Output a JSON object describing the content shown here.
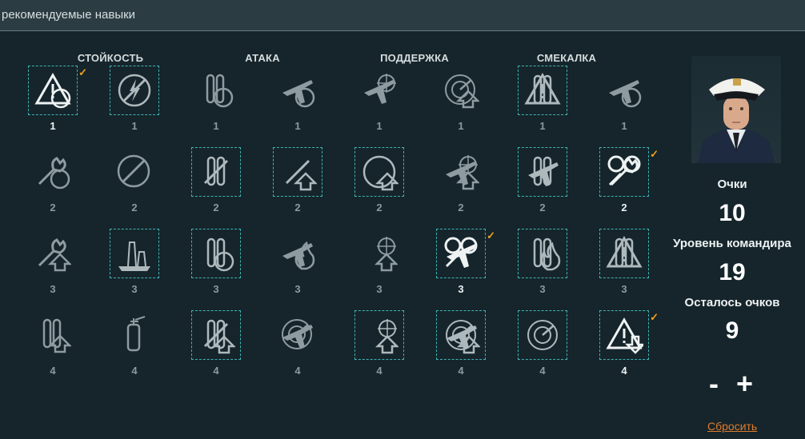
{
  "header": {
    "title": "рекомендуемые навыки"
  },
  "categories": [
    "СТОЙКОСТЬ",
    "АТАКА",
    "ПОДДЕРЖКА",
    "СМЕКАЛКА"
  ],
  "colors": {
    "accent_border": "#3fb3b6",
    "check": "#f0a21c",
    "reset_link": "#e07b2e"
  },
  "rows": [
    {
      "cost": "1",
      "skills": [
        {
          "icon": "warning-target-icon",
          "selected": true,
          "checked": true
        },
        {
          "icon": "no-lightning-icon",
          "selected": true,
          "checked": false
        },
        {
          "icon": "torpedo-timer-icon",
          "selected": false,
          "checked": false
        },
        {
          "icon": "plane-timer-icon",
          "selected": false,
          "checked": false
        },
        {
          "icon": "plane-crosshair-icon",
          "selected": false,
          "checked": false
        },
        {
          "icon": "radar-upgrade-icon",
          "selected": false,
          "checked": false
        },
        {
          "icon": "ship-warning-icon",
          "selected": true,
          "checked": false
        },
        {
          "icon": "plane-heal-icon",
          "selected": false,
          "checked": false
        }
      ]
    },
    {
      "cost": "2",
      "skills": [
        {
          "icon": "wrench-timer-icon",
          "selected": false,
          "checked": false
        },
        {
          "icon": "stopwatch-icon",
          "selected": false,
          "checked": false
        },
        {
          "icon": "gun-barrels-icon",
          "selected": true,
          "checked": false
        },
        {
          "icon": "shell-arrow-icon",
          "selected": true,
          "checked": false
        },
        {
          "icon": "armor-upgrade-icon",
          "selected": true,
          "checked": false
        },
        {
          "icon": "plane-target-upgrade-icon",
          "selected": false,
          "checked": false
        },
        {
          "icon": "torpedoes-plane-icon",
          "selected": true,
          "checked": false
        },
        {
          "icon": "gears-wrench-icon",
          "selected": true,
          "checked": true
        }
      ]
    },
    {
      "cost": "3",
      "skills": [
        {
          "icon": "wrench-upgrade-icon",
          "selected": false,
          "checked": false
        },
        {
          "icon": "battleship-icon",
          "selected": true,
          "checked": false
        },
        {
          "icon": "guns-timer-icon",
          "selected": true,
          "checked": false
        },
        {
          "icon": "plane-fire-icon",
          "selected": false,
          "checked": false
        },
        {
          "icon": "aa-upgrade-icon",
          "selected": false,
          "checked": false
        },
        {
          "icon": "plane-heal-squadron-icon",
          "selected": true,
          "checked": true
        },
        {
          "icon": "torpedo-fire-icon",
          "selected": true,
          "checked": false
        },
        {
          "icon": "guns-warning-icon",
          "selected": true,
          "checked": false
        }
      ]
    },
    {
      "cost": "4",
      "skills": [
        {
          "icon": "shells-upgrade-icon",
          "selected": false,
          "checked": false
        },
        {
          "icon": "extinguisher-icon",
          "selected": false,
          "checked": false
        },
        {
          "icon": "crossed-guns-upgrade-icon",
          "selected": true,
          "checked": false
        },
        {
          "icon": "planes-radar-icon",
          "selected": false,
          "checked": false
        },
        {
          "icon": "plane-double-upgrade-icon",
          "selected": true,
          "checked": false
        },
        {
          "icon": "plane-radar-upgrade-icon",
          "selected": true,
          "checked": false
        },
        {
          "icon": "radar-compass-icon",
          "selected": true,
          "checked": false
        },
        {
          "icon": "warning-down-icon",
          "selected": true,
          "checked": true
        }
      ]
    }
  ],
  "commander": {
    "points_label": "Очки",
    "points_value": "10",
    "level_label": "Уровень командира",
    "level_value": "19",
    "remaining_label": "Осталось очков",
    "remaining_value": "9",
    "minus_label": "-",
    "plus_label": "+",
    "reset_label": "Сбросить"
  }
}
